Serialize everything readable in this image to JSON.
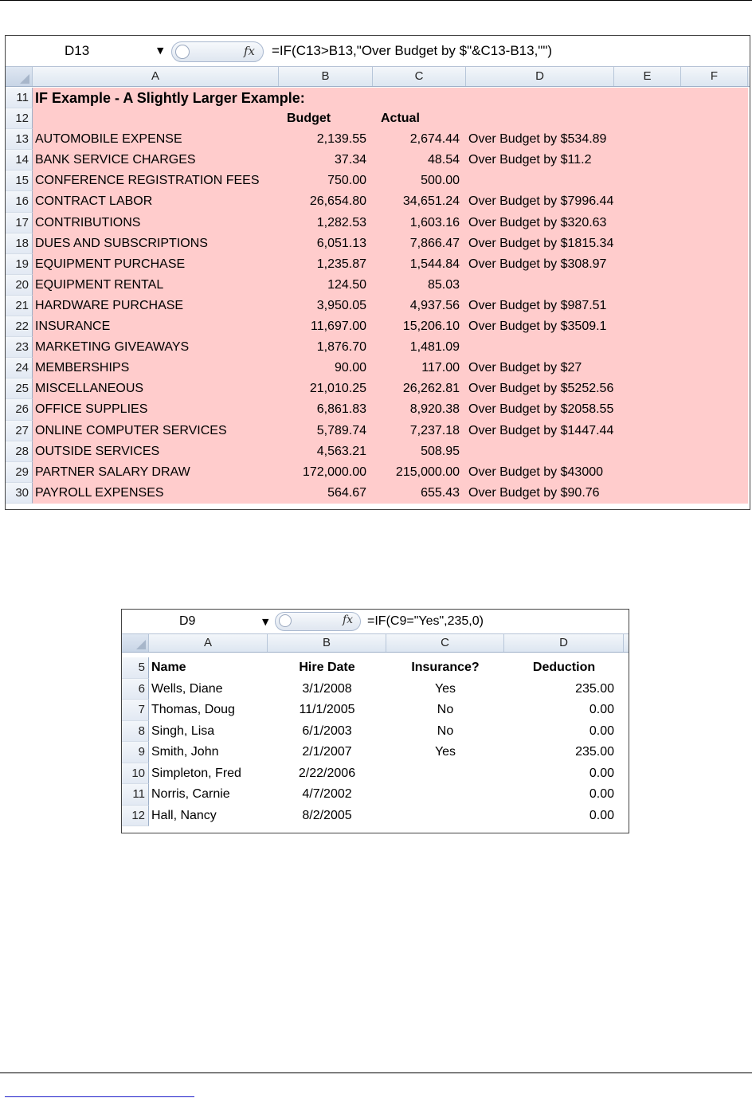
{
  "sheet1": {
    "name_box": "D13",
    "fx": "fx",
    "formula": "=IF(C13>B13,\"Over Budget by $\"&C13-B13,\"\")",
    "columns": [
      "A",
      "B",
      "C",
      "D",
      "E",
      "F"
    ],
    "title_row": {
      "row": "11",
      "text": "IF Example - A Slightly Larger Example:"
    },
    "header_row": {
      "row": "12",
      "budget": "Budget",
      "actual": "Actual"
    },
    "rows": [
      {
        "row": "13",
        "a": "AUTOMOBILE EXPENSE",
        "b": "2,139.55",
        "c": "2,674.44",
        "d": "Over Budget by $534.89"
      },
      {
        "row": "14",
        "a": "BANK SERVICE CHARGES",
        "b": "37.34",
        "c": "48.54",
        "d": "Over Budget by $11.2"
      },
      {
        "row": "15",
        "a": "CONFERENCE REGISTRATION FEES",
        "b": "750.00",
        "c": "500.00",
        "d": ""
      },
      {
        "row": "16",
        "a": "CONTRACT LABOR",
        "b": "26,654.80",
        "c": "34,651.24",
        "d": "Over Budget by $7996.44"
      },
      {
        "row": "17",
        "a": "CONTRIBUTIONS",
        "b": "1,282.53",
        "c": "1,603.16",
        "d": "Over Budget by $320.63"
      },
      {
        "row": "18",
        "a": "DUES AND SUBSCRIPTIONS",
        "b": "6,051.13",
        "c": "7,866.47",
        "d": "Over Budget by $1815.34"
      },
      {
        "row": "19",
        "a": "EQUIPMENT PURCHASE",
        "b": "1,235.87",
        "c": "1,544.84",
        "d": "Over Budget by $308.97"
      },
      {
        "row": "20",
        "a": "EQUIPMENT RENTAL",
        "b": "124.50",
        "c": "85.03",
        "d": ""
      },
      {
        "row": "21",
        "a": "HARDWARE PURCHASE",
        "b": "3,950.05",
        "c": "4,937.56",
        "d": "Over Budget by $987.51"
      },
      {
        "row": "22",
        "a": "INSURANCE",
        "b": "11,697.00",
        "c": "15,206.10",
        "d": "Over Budget by $3509.1"
      },
      {
        "row": "23",
        "a": "MARKETING GIVEAWAYS",
        "b": "1,876.70",
        "c": "1,481.09",
        "d": ""
      },
      {
        "row": "24",
        "a": "MEMBERSHIPS",
        "b": "90.00",
        "c": "117.00",
        "d": "Over Budget by $27"
      },
      {
        "row": "25",
        "a": "MISCELLANEOUS",
        "b": "21,010.25",
        "c": "26,262.81",
        "d": "Over Budget by $5252.56"
      },
      {
        "row": "26",
        "a": "OFFICE SUPPLIES",
        "b": "6,861.83",
        "c": "8,920.38",
        "d": "Over Budget by $2058.55"
      },
      {
        "row": "27",
        "a": "ONLINE COMPUTER SERVICES",
        "b": "5,789.74",
        "c": "7,237.18",
        "d": "Over Budget by $1447.44"
      },
      {
        "row": "28",
        "a": "OUTSIDE SERVICES",
        "b": "4,563.21",
        "c": "508.95",
        "d": ""
      },
      {
        "row": "29",
        "a": "PARTNER SALARY DRAW",
        "b": "172,000.00",
        "c": "215,000.00",
        "d": "Over Budget by $43000"
      },
      {
        "row": "30",
        "a": "PAYROLL EXPENSES",
        "b": "564.67",
        "c": "655.43",
        "d": "Over Budget by $90.76"
      }
    ],
    "highlight_color": "#ffcccc"
  },
  "sheet2": {
    "name_box": "D9",
    "fx": "fx",
    "formula": "=IF(C9=\"Yes\",235,0)",
    "columns": [
      "A",
      "B",
      "C",
      "D"
    ],
    "header_row": {
      "row": "5",
      "name": "Name",
      "hire_date": "Hire Date",
      "insurance": "Insurance?",
      "deduction": "Deduction"
    },
    "rows": [
      {
        "row": "6",
        "name": "Wells, Diane",
        "hire": "3/1/2008",
        "ins": "Yes",
        "ded": "235.00"
      },
      {
        "row": "7",
        "name": "Thomas, Doug",
        "hire": "11/1/2005",
        "ins": "No",
        "ded": "0.00"
      },
      {
        "row": "8",
        "name": "Singh, Lisa",
        "hire": "6/1/2003",
        "ins": "No",
        "ded": "0.00"
      },
      {
        "row": "9",
        "name": "Smith, John",
        "hire": "2/1/2007",
        "ins": "Yes",
        "ded": "235.00"
      },
      {
        "row": "10",
        "name": "Simpleton, Fred",
        "hire": "2/22/2006",
        "ins": "",
        "ded": "0.00"
      },
      {
        "row": "11",
        "name": "Norris, Carnie",
        "hire": "4/7/2002",
        "ins": "",
        "ded": "0.00"
      },
      {
        "row": "12",
        "name": "Hall, Nancy",
        "hire": "8/2/2005",
        "ins": "",
        "ded": "0.00"
      }
    ]
  }
}
